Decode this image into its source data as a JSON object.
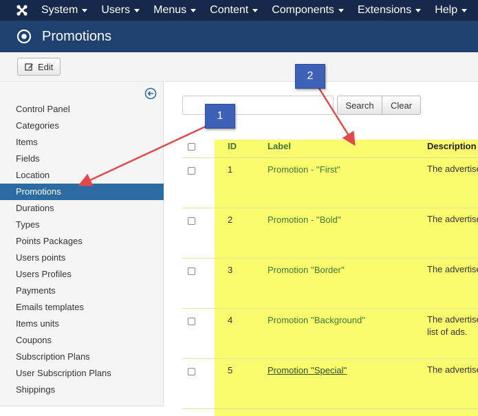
{
  "topnav": {
    "logo_icon": "joomla-icon",
    "menus": [
      "System",
      "Users",
      "Menus",
      "Content",
      "Components",
      "Extensions",
      "Help"
    ]
  },
  "titlebar": {
    "icon": "target-icon",
    "title": "Promotions"
  },
  "toolbar": {
    "edit_label": "Edit",
    "edit_icon": "edit-icon"
  },
  "sidebar": {
    "collapse_icon": "arrow-left-circle-icon",
    "items": [
      {
        "label": "Control Panel",
        "active": false
      },
      {
        "label": "Categories",
        "active": false
      },
      {
        "label": "Items",
        "active": false
      },
      {
        "label": "Fields",
        "active": false
      },
      {
        "label": "Location",
        "active": false
      },
      {
        "label": "Promotions",
        "active": true
      },
      {
        "label": "Durations",
        "active": false
      },
      {
        "label": "Types",
        "active": false
      },
      {
        "label": "Points Packages",
        "active": false
      },
      {
        "label": "Users points",
        "active": false
      },
      {
        "label": "Users Profiles",
        "active": false
      },
      {
        "label": "Payments",
        "active": false
      },
      {
        "label": "Emails templates",
        "active": false
      },
      {
        "label": "Items units",
        "active": false
      },
      {
        "label": "Coupons",
        "active": false
      },
      {
        "label": "Subscription Plans",
        "active": false
      },
      {
        "label": "User Subscription Plans",
        "active": false
      },
      {
        "label": "Shippings",
        "active": false
      }
    ]
  },
  "search": {
    "value": "",
    "placeholder": "",
    "search_label": "Search",
    "clear_label": "Clear"
  },
  "table": {
    "headers": {
      "id": "ID",
      "label": "Label",
      "description": "Description"
    },
    "rows": [
      {
        "id": "1",
        "label": "Promotion - ''First''",
        "description": [
          "The advertise"
        ]
      },
      {
        "id": "2",
        "label": "Promotion - ''Bold''",
        "description": [
          "The advertise"
        ]
      },
      {
        "id": "3",
        "label": "Promotion ''Border''",
        "description": [
          "The advertise"
        ]
      },
      {
        "id": "4",
        "label": "Promotion ''Background''",
        "description": [
          "The advertise",
          "list of ads."
        ]
      },
      {
        "id": "5",
        "label": "Promotion ''Special''",
        "description": [
          "The advertise"
        ]
      }
    ]
  },
  "annotations": {
    "callout_1": "1",
    "callout_2": "2",
    "highlight_color": "#fbfb6e",
    "arrow_color": "#e04a4a"
  },
  "colors": {
    "topnav": "#17294a",
    "titlebar": "#1e416f",
    "active_sidebar": "#2d6ca2",
    "link_green": "#3a7b3a"
  }
}
